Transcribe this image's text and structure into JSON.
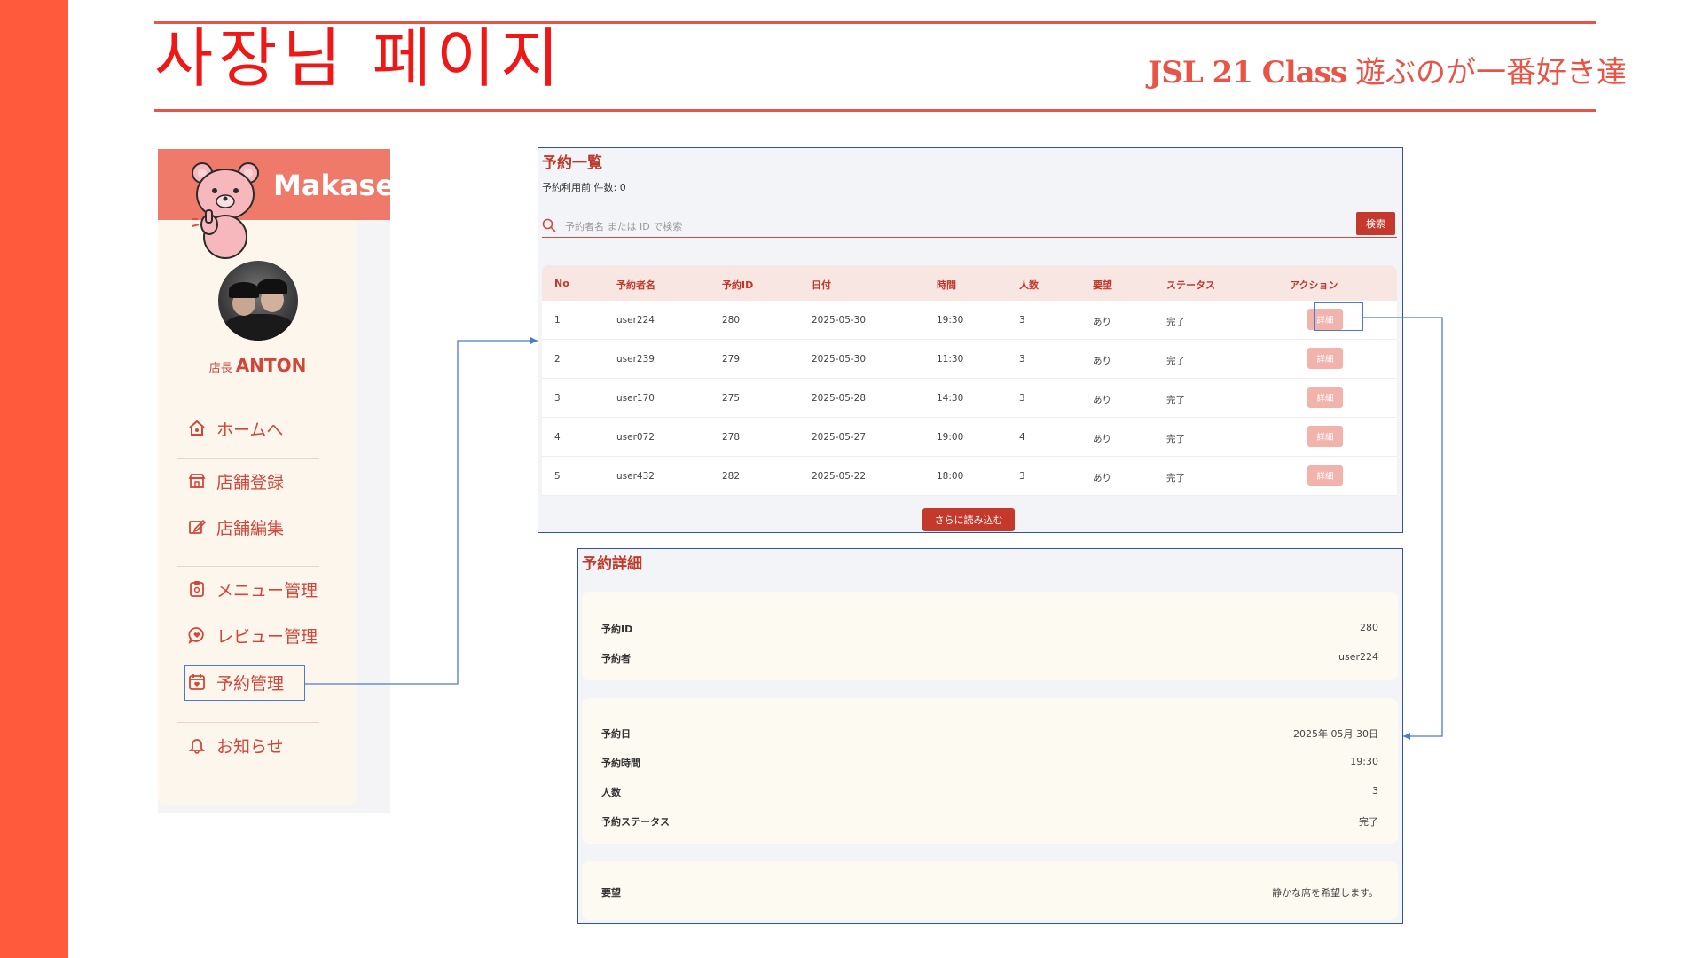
{
  "slide": {
    "title": "사장님 페이지",
    "brand_main": "JSL 21 Class",
    "brand_sub": "遊ぶのが一番好き達"
  },
  "sidebar": {
    "logo": "Makaset",
    "owner_role": "店長",
    "owner_name": "ANTON",
    "items": [
      {
        "label": "ホームへ",
        "icon": "home-icon"
      },
      {
        "label": "店舗登録",
        "icon": "store-icon"
      },
      {
        "label": "店舗編集",
        "icon": "edit-icon"
      },
      {
        "label": "メニュー管理",
        "icon": "clipboard-icon"
      },
      {
        "label": "レビュー管理",
        "icon": "review-icon"
      },
      {
        "label": "予約管理",
        "icon": "calendar-icon"
      },
      {
        "label": "お知らせ",
        "icon": "bell-icon"
      }
    ]
  },
  "reservation_list": {
    "title": "予約一覧",
    "count_label": "予約利用前 件数: 0",
    "search_placeholder": "予約者名 または ID で検索",
    "search_button": "検索",
    "columns": [
      "No",
      "予約者名",
      "予約ID",
      "日付",
      "時間",
      "人数",
      "要望",
      "ステータス",
      "アクション"
    ],
    "rows": [
      {
        "no": "1",
        "name": "user224",
        "id": "280",
        "date": "2025-05-30",
        "time": "19:30",
        "people": "3",
        "request": "あり",
        "status": "完了",
        "action": "詳細"
      },
      {
        "no": "2",
        "name": "user239",
        "id": "279",
        "date": "2025-05-30",
        "time": "11:30",
        "people": "3",
        "request": "あり",
        "status": "完了",
        "action": "詳細"
      },
      {
        "no": "3",
        "name": "user170",
        "id": "275",
        "date": "2025-05-28",
        "time": "14:30",
        "people": "3",
        "request": "あり",
        "status": "完了",
        "action": "詳細"
      },
      {
        "no": "4",
        "name": "user072",
        "id": "278",
        "date": "2025-05-27",
        "time": "19:00",
        "people": "4",
        "request": "あり",
        "status": "完了",
        "action": "詳細"
      },
      {
        "no": "5",
        "name": "user432",
        "id": "282",
        "date": "2025-05-22",
        "time": "18:00",
        "people": "3",
        "request": "あり",
        "status": "完了",
        "action": "詳細"
      }
    ],
    "more_button": "さらに読み込む"
  },
  "reservation_detail": {
    "title": "予約詳細",
    "cards": [
      [
        {
          "label": "予約ID",
          "value": "280"
        },
        {
          "label": "予約者",
          "value": "user224"
        }
      ],
      [
        {
          "label": "予約日",
          "value": "2025年 05月 30日"
        },
        {
          "label": "予約時間",
          "value": "19:30"
        },
        {
          "label": "人数",
          "value": "3"
        },
        {
          "label": "予約ステータス",
          "value": "完了"
        }
      ],
      [
        {
          "label": "要望",
          "value": "静かな席を希望します。"
        }
      ]
    ]
  },
  "colors": {
    "accent": "#ea5446",
    "left_bar": "#ff5a3c",
    "title_red": "#f01717",
    "connector": "#4a7bd0"
  }
}
